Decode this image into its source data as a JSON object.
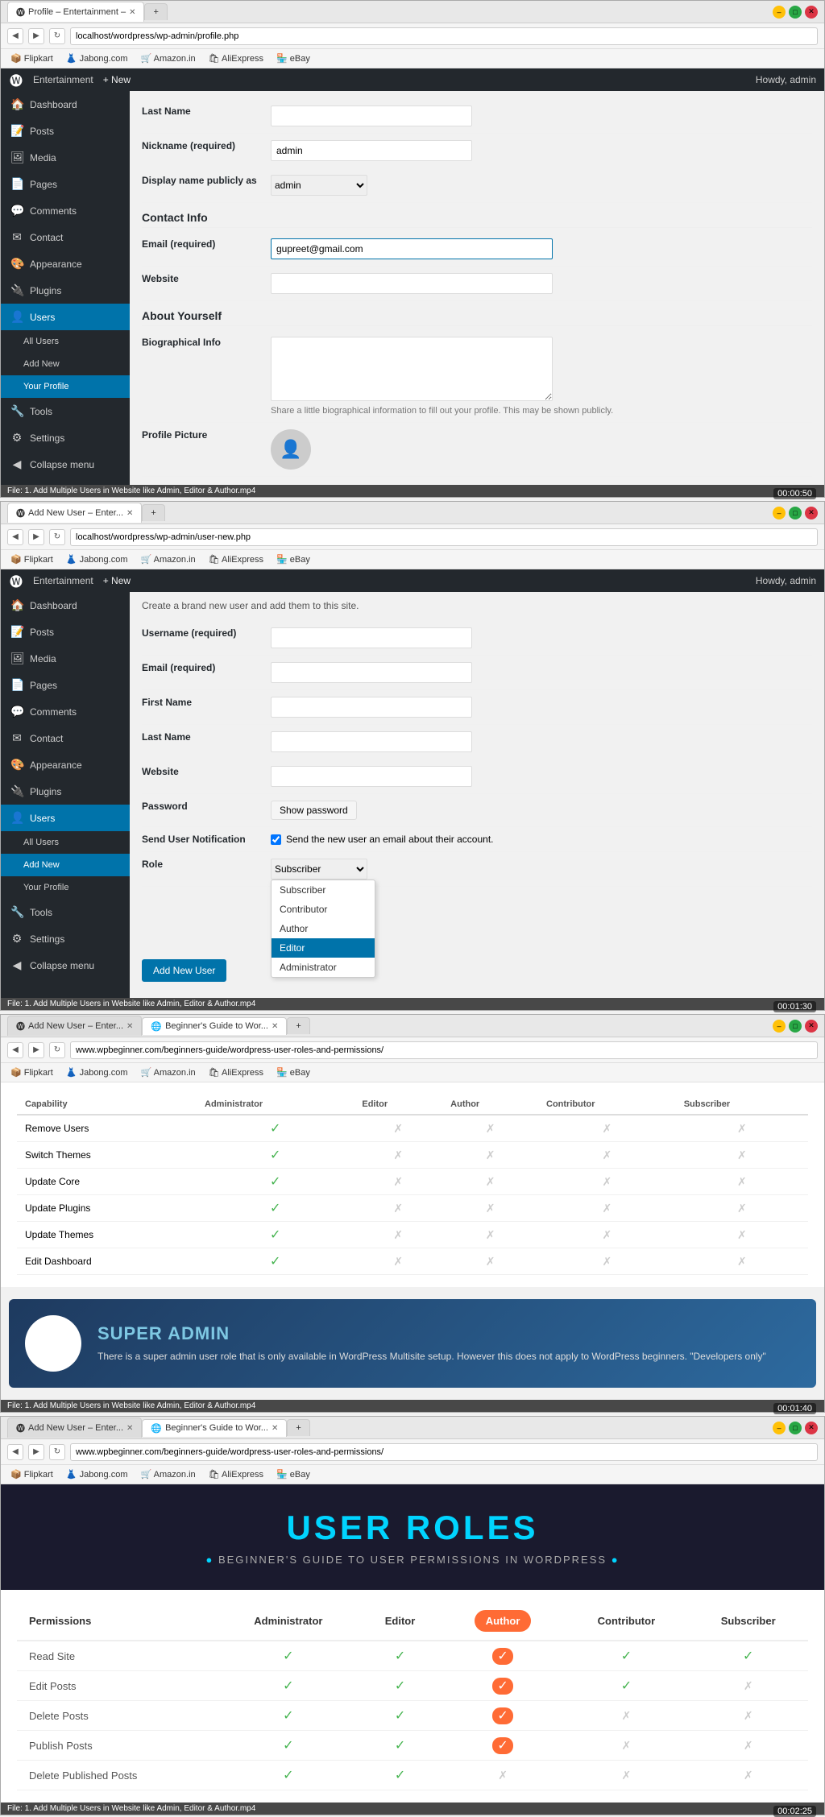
{
  "windows": [
    {
      "id": "window1",
      "tab1": {
        "label": "Profile – Entertainment –",
        "active": true
      },
      "tab2": {
        "label": "+",
        "active": false
      },
      "address": "localhost/wordpress/wp-admin/profile.php",
      "bookmarks": [
        "Flipkart",
        "Jabong.com",
        "Amazon.in",
        "AliExpress",
        "eBay"
      ],
      "timestamp": "00:00:50",
      "admin_bar": {
        "site": "Entertainment",
        "howdy": "Howdy, admin"
      },
      "sidebar": {
        "items": [
          {
            "icon": "🏠",
            "label": "Dashboard"
          },
          {
            "icon": "📝",
            "label": "Posts"
          },
          {
            "icon": "🖼",
            "label": "Media"
          },
          {
            "icon": "📄",
            "label": "Pages"
          },
          {
            "icon": "💬",
            "label": "Comments"
          },
          {
            "icon": "🔵",
            "label": "Contact"
          },
          {
            "icon": "🎨",
            "label": "Appearance"
          },
          {
            "icon": "🔌",
            "label": "Plugins"
          },
          {
            "icon": "👤",
            "label": "Users",
            "active": true
          },
          {
            "icon": "🔧",
            "label": "Tools"
          },
          {
            "icon": "⚙",
            "label": "Settings"
          },
          {
            "icon": "◀",
            "label": "Collapse menu"
          }
        ],
        "sub_items": [
          {
            "label": "All Users"
          },
          {
            "label": "Add New"
          },
          {
            "label": "Your Profile",
            "active": true
          }
        ]
      },
      "form": {
        "section_contact": "Contact Info",
        "section_about": "About Yourself",
        "fields": [
          {
            "label": "Last Name",
            "value": "",
            "type": "text"
          },
          {
            "label": "Nickname (required)",
            "value": "admin",
            "type": "text"
          },
          {
            "label": "Display name publicly as",
            "value": "admin",
            "type": "select"
          },
          {
            "label": "Email (required)",
            "value": "gupreet@gmail.com",
            "type": "text"
          },
          {
            "label": "Website",
            "value": "",
            "type": "text"
          },
          {
            "label": "Biographical Info",
            "value": "",
            "type": "textarea"
          }
        ],
        "profile_picture_label": "Profile Picture",
        "bio_hint": "Share a little biographical information to fill out your profile. This may be shown publicly."
      }
    },
    {
      "id": "window2",
      "tab1": {
        "label": "Add New User – Enter...",
        "active": true
      },
      "tab2": {
        "label": "+",
        "active": false
      },
      "address": "localhost/wordpress/wp-admin/user-new.php",
      "bookmarks": [
        "Flipkart",
        "Jabong.com",
        "Amazon.in",
        "AliExpress",
        "eBay"
      ],
      "timestamp": "00:01:30",
      "admin_bar": {
        "site": "Entertainment",
        "howdy": "Howdy, admin"
      },
      "sidebar": {
        "items": [
          {
            "icon": "🏠",
            "label": "Dashboard"
          },
          {
            "icon": "📝",
            "label": "Posts"
          },
          {
            "icon": "🖼",
            "label": "Media"
          },
          {
            "icon": "📄",
            "label": "Pages"
          },
          {
            "icon": "💬",
            "label": "Comments"
          },
          {
            "icon": "🔵",
            "label": "Contact"
          },
          {
            "icon": "🎨",
            "label": "Appearance"
          },
          {
            "icon": "🔌",
            "label": "Plugins"
          },
          {
            "icon": "👤",
            "label": "Users",
            "active": true
          },
          {
            "icon": "🔧",
            "label": "Tools"
          },
          {
            "icon": "⚙",
            "label": "Settings"
          },
          {
            "icon": "◀",
            "label": "Collapse menu"
          }
        ],
        "sub_items": [
          {
            "label": "All Users"
          },
          {
            "label": "Add New",
            "active": true
          },
          {
            "label": "Your Profile"
          }
        ]
      },
      "notice": "Create a brand new user and add them to this site.",
      "form_fields": [
        {
          "label": "Username (required)",
          "value": ""
        },
        {
          "label": "Email (required)",
          "value": ""
        },
        {
          "label": "First Name",
          "value": ""
        },
        {
          "label": "Last Name",
          "value": ""
        },
        {
          "label": "Website",
          "value": ""
        }
      ],
      "password_label": "Password",
      "show_password_btn": "Show password",
      "notification_label": "Send User Notification",
      "notification_text": "Send the new user an email about their account.",
      "role_label": "Role",
      "role_current": "Subscriber",
      "role_options": [
        "Subscriber",
        "Contributor",
        "Author",
        "Editor",
        "Administrator"
      ],
      "role_active": "Editor",
      "add_button": "Add New User"
    },
    {
      "id": "window3",
      "tab1": {
        "label": "Add New User – Enter...",
        "active": false
      },
      "tab2": {
        "label": "Beginner's Guide to Wor...",
        "active": true
      },
      "tab3": {
        "label": "+",
        "active": false
      },
      "address": "www.wpbeginner.com/beginners-guide/wordpress-user-roles-and-permissions/",
      "bookmarks": [
        "Flipkart",
        "Jabong.com",
        "Amazon.in",
        "AliExpress",
        "eBay"
      ],
      "timestamp": "00:01:40",
      "perm_table": {
        "rows": [
          {
            "label": "Remove Users",
            "admin": true,
            "editor": false,
            "author": false,
            "contributor": false,
            "subscriber": false
          },
          {
            "label": "Switch Themes",
            "admin": true,
            "editor": false,
            "author": false,
            "contributor": false,
            "subscriber": false
          },
          {
            "label": "Update Core",
            "admin": true,
            "editor": false,
            "author": false,
            "contributor": false,
            "subscriber": false
          },
          {
            "label": "Update Plugins",
            "admin": true,
            "editor": false,
            "author": false,
            "contributor": false,
            "subscriber": false
          },
          {
            "label": "Update Themes",
            "admin": true,
            "editor": false,
            "author": false,
            "contributor": false,
            "subscriber": false
          },
          {
            "label": "Edit Dashboard",
            "admin": true,
            "editor": false,
            "author": false,
            "contributor": false,
            "subscriber": false
          }
        ]
      },
      "super_admin": {
        "title": "SUPER ADMIN",
        "text": "There is a super admin user role that is only available in WordPress Multisite setup. However this does not apply to WordPress beginners. \"Developers only\""
      }
    },
    {
      "id": "window4",
      "tab1": {
        "label": "Add New User – Enter...",
        "active": false
      },
      "tab2": {
        "label": "Beginner's Guide to Wor...",
        "active": true
      },
      "tab3": {
        "label": "+",
        "active": false
      },
      "address": "www.wpbeginner.com/beginners-guide/wordpress-user-roles-and-permissions/",
      "bookmarks": [
        "Flipkart",
        "Jabong.com",
        "Amazon.in",
        "AliExpress",
        "eBay"
      ],
      "timestamp": "00:02:25",
      "user_roles_title": "USER ROLES",
      "user_roles_subtitle": "BEGINNER'S GUIDE TO USER PERMISSIONS IN WORDPRESS",
      "columns": [
        "Permissions",
        "Administrator",
        "Editor",
        "Author",
        "Contributor",
        "Subscriber"
      ],
      "highlighted_col": "Author",
      "rows": [
        {
          "label": "Read Site",
          "admin": true,
          "editor": true,
          "author": true,
          "contributor": true,
          "subscriber": true
        },
        {
          "label": "Edit Posts",
          "admin": true,
          "editor": true,
          "author": true,
          "contributor": true,
          "subscriber": false
        },
        {
          "label": "Delete Posts",
          "admin": true,
          "editor": true,
          "author": true,
          "contributor": false,
          "subscriber": false
        },
        {
          "label": "Publish Posts",
          "admin": true,
          "editor": true,
          "author": true,
          "contributor": false,
          "subscriber": false
        },
        {
          "label": "Delete Published Posts",
          "admin": true,
          "editor": true,
          "author": false,
          "contributor": false,
          "subscriber": false
        }
      ]
    }
  ]
}
